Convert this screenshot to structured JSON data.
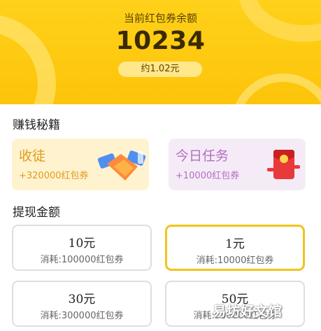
{
  "balance": {
    "label": "当前红包券余额",
    "value": "10234",
    "approx": "约1.02元"
  },
  "earn_section": {
    "title": "赚钱秘籍",
    "tasks": [
      {
        "name": "收徒",
        "reward": "+320000红包券",
        "icon": "handshake-icon"
      },
      {
        "name": "今日任务",
        "reward": "+10000红包券",
        "icon": "red-envelope-icon"
      }
    ]
  },
  "withdraw_section": {
    "title": "提现金额",
    "options": [
      {
        "amount": "10元",
        "cost": "消耗:100000红包券",
        "selected": false
      },
      {
        "amount": "1元",
        "cost": "消耗:10000红包券",
        "selected": true
      },
      {
        "amount": "30元",
        "cost": "消耗:300000红包券",
        "selected": false
      },
      {
        "amount": "50元",
        "cost": "消耗:500000红包券",
        "selected": false
      }
    ]
  },
  "watermark": "易坊好文馆",
  "colors": {
    "header": "#fcc40a",
    "selected_border": "#f2c31d",
    "apprentice_text": "#e19a1c",
    "daily_text": "#b46fc0"
  }
}
